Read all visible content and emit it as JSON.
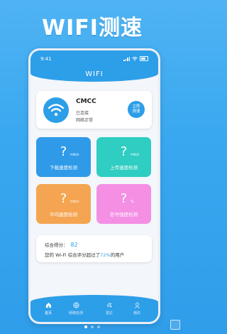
{
  "headline": "WIFI测速",
  "status_bar": {
    "time": "9:41"
  },
  "screen_title": "WIFI",
  "network": {
    "name": "CMCC",
    "status": "已连接",
    "quality": "网络正常",
    "measure_label_line1": "立即",
    "measure_label_line2": "测速"
  },
  "tiles": {
    "download": {
      "value": "?",
      "unit": "mb/s",
      "label": "下载速度检测",
      "color": "#2f9ae8"
    },
    "upload": {
      "value": "?",
      "unit": "mb/s",
      "label": "上传速度检测",
      "color": "#2fcdc2"
    },
    "average": {
      "value": "?",
      "unit": "mb/s",
      "label": "平均速度检测",
      "color": "#f5a551"
    },
    "signal": {
      "value": "?",
      "unit": "%",
      "label": "信号强度检测",
      "color": "#f48fe4"
    }
  },
  "score": {
    "label": "综合得分：",
    "value": "82",
    "desc_prefix": "您的 Wi-Fi 综合评分超过了",
    "percent": "72%",
    "desc_suffix": "的用户"
  },
  "tabbar": {
    "items": [
      {
        "label": "首页",
        "icon": "home-icon",
        "active": true
      },
      {
        "label": "网络检测",
        "icon": "globe-icon",
        "active": false
      },
      {
        "label": "雷达",
        "icon": "radar-icon",
        "active": false
      },
      {
        "label": "我的",
        "icon": "user-icon",
        "active": false
      }
    ]
  },
  "colors": {
    "primary": "#2d9ee8",
    "background": "#3aa8f0"
  }
}
